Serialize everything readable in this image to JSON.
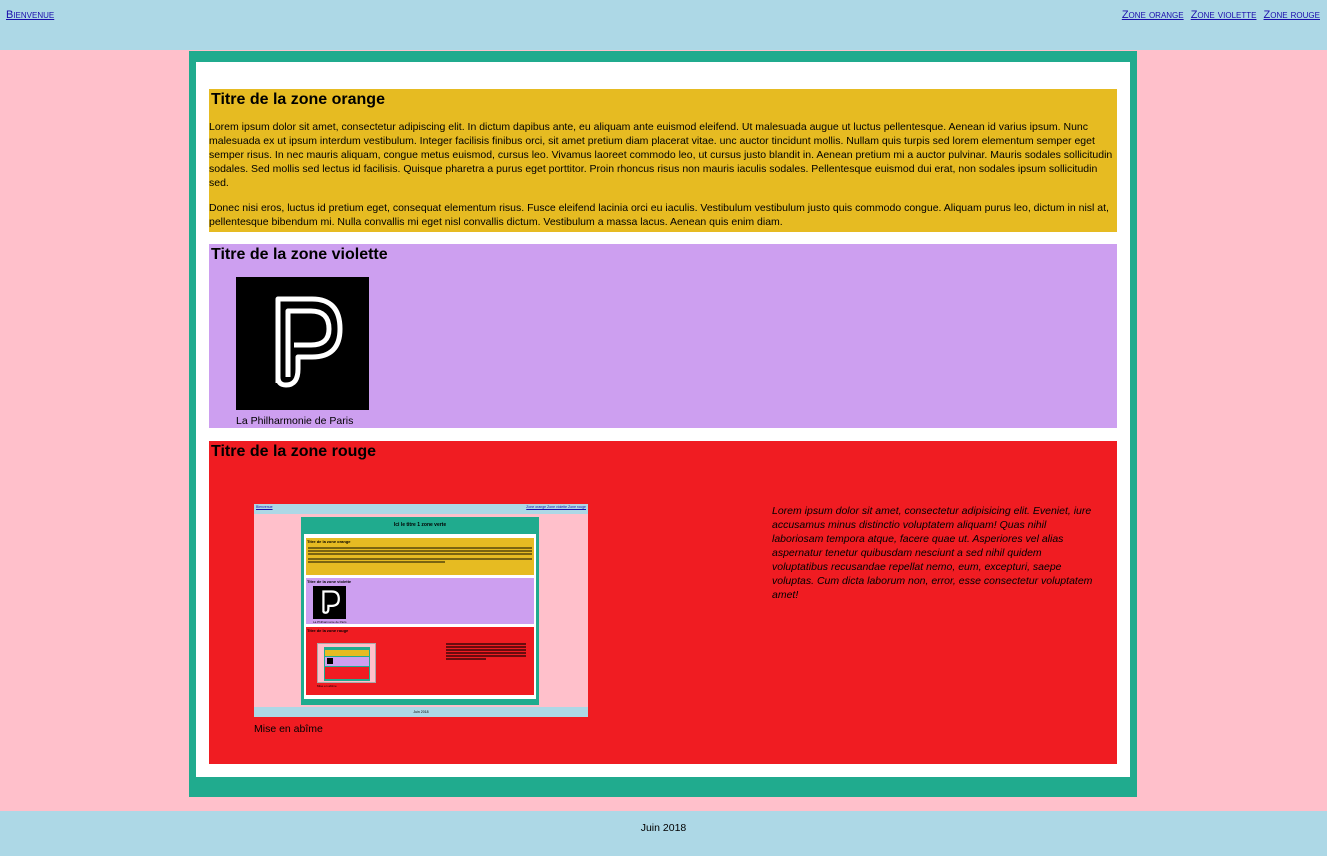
{
  "nav": {
    "home": "Bienvenue",
    "links": [
      "Zone orange",
      "Zone violette",
      "Zone rouge"
    ]
  },
  "orange": {
    "title": "Titre de la zone orange",
    "p1": "Lorem ipsum dolor sit amet, consectetur adipiscing elit. In dictum dapibus ante, eu aliquam ante euismod eleifend. Ut malesuada augue ut luctus pellentesque. Aenean id varius ipsum. Nunc malesuada ex ut ipsum interdum vestibulum. Integer facilisis finibus orci, sit amet pretium diam placerat vitae. unc auctor tincidunt mollis. Nullam quis turpis sed lorem elementum semper eget semper risus. In nec mauris aliquam, congue metus euismod, cursus leo. Vivamus laoreet commodo leo, ut cursus justo blandit in. Aenean pretium mi a auctor pulvinar. Mauris sodales sollicitudin sodales. Sed mollis sed lectus id facilisis. Quisque pharetra a purus eget porttitor. Proin rhoncus risus non mauris iaculis sodales. Pellentesque euismod dui erat, non sodales ipsum sollicitudin sed.",
    "p2": "Donec nisi eros, luctus id pretium eget, consequat elementum risus. Fusce eleifend lacinia orci eu iaculis. Vestibulum vestibulum justo quis commodo congue. Aliquam purus leo, dictum in nisl at, pellentesque bibendum mi. Nulla convallis mi eget nisl convallis dictum. Vestibulum a massa lacus. Aenean quis enim diam."
  },
  "violet": {
    "title": "Titre de la zone violette",
    "caption": "La Philharmonie de Paris"
  },
  "red": {
    "title": "Titre de la zone rouge",
    "caption": "Mise en abîme",
    "quote": "Lorem ipsum dolor sit amet, consectetur adipisicing elit. Eveniet, iure accusamus minus distinctio voluptatem aliquam! Quas nihil laboriosam tempora atque, facere quae ut. Asperiores vel alias aspernatur tenetur quibusdam nesciunt a sed nihil quidem voluptatibus recusandae repellat nemo, eum, excepturi, saepe voluptas. Cum dicta laborum non, error, esse consectetur voluptatem amet!"
  },
  "thumbnail": {
    "home": "Bienvenue",
    "links": "Zone orange Zone violette Zone rouge",
    "title": "Ici le titre 1 zone verte",
    "orange_title": "Titre de la zone orange",
    "violet_title": "Titre de la zone violette",
    "violet_caption": "La Philharmonie de Paris",
    "red_title": "Titre de la zone rouge",
    "caption": "Mise en abîme",
    "footer": "Juin 2018"
  },
  "footer": {
    "text": "Juin 2018"
  },
  "colors": {
    "header": "#add8e6",
    "background": "#ffc0cb",
    "green": "#20ab8e",
    "orange": "#e6bb22",
    "violet": "#cd9ff0",
    "red": "#f01c22"
  }
}
